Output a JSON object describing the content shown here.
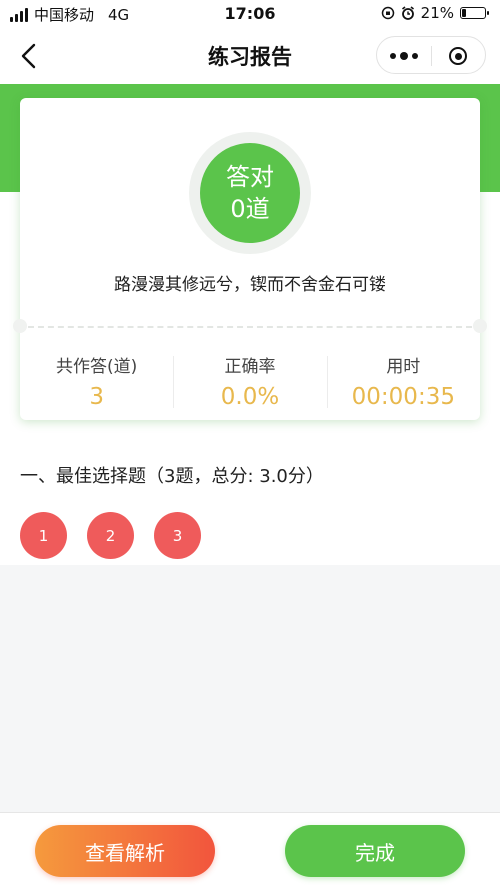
{
  "status_bar": {
    "carrier": "中国移动",
    "network": "4G",
    "time": "17:06",
    "battery": "21%",
    "battery_level": 0.21
  },
  "nav": {
    "title": "练习报告"
  },
  "result": {
    "correct_label": "答对",
    "correct_count": "0道",
    "motto": "路漫漫其修远兮，锲而不舍金石可镂"
  },
  "stats": [
    {
      "label": "共作答(道)",
      "value": "3"
    },
    {
      "label": "正确率",
      "value": "0.0%"
    },
    {
      "label": "用时",
      "value": "00:00:35"
    }
  ],
  "section": {
    "title": "一、最佳选择题（3题，总分: 3.0分）",
    "questions": [
      "1",
      "2",
      "3"
    ]
  },
  "footer": {
    "analysis_label": "查看解析",
    "done_label": "完成"
  },
  "colors": {
    "green": "#5bc44b",
    "wrong": "#ef5b5b",
    "stat_value": "#e8b84d",
    "analysis_gradient_start": "#f59a3d",
    "analysis_gradient_end": "#f2553d"
  }
}
